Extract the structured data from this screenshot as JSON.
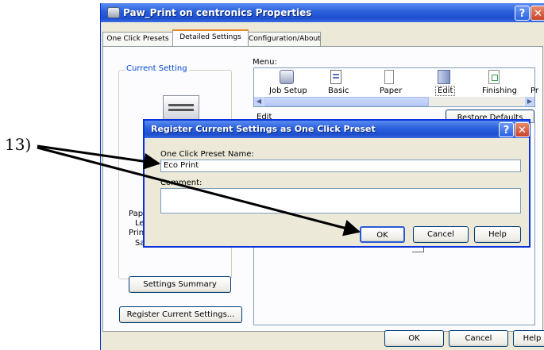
{
  "window": {
    "title": "Paw_Print on centronics Properties"
  },
  "tabs": [
    {
      "label": "One Click Presets"
    },
    {
      "label": "Detailed Settings"
    },
    {
      "label": "Configuration/About"
    }
  ],
  "left_panel": {
    "current_setting_label": "Current Setting",
    "info_lines": [
      "Pape",
      "Lett",
      "Print",
      "San"
    ],
    "settings_summary_button": "Settings Summary",
    "register_button": "Register Current Settings..."
  },
  "menu": {
    "label": "Menu:",
    "items": [
      {
        "label": "Job Setup",
        "icon": "job-setup-icon"
      },
      {
        "label": "Basic",
        "icon": "basic-icon"
      },
      {
        "label": "Paper",
        "icon": "paper-icon"
      },
      {
        "label": "Edit",
        "icon": "edit-icon"
      },
      {
        "label": "Finishing",
        "icon": "finishing-icon"
      },
      {
        "label": "Pr",
        "icon": ""
      }
    ],
    "selected": "Edit"
  },
  "edit_section": {
    "label": "Edit",
    "restore_defaults": "Restore Defaults"
  },
  "dialog": {
    "title": "Register Current Settings as One Click Preset",
    "name_label": "One Click Preset Name:",
    "name_value": "Eco Print",
    "comment_label": "Comment:",
    "comment_value": "",
    "ok": "OK",
    "cancel": "Cancel",
    "help": "Help"
  },
  "bottom_buttons": {
    "ok": "OK",
    "cancel": "Cancel",
    "help": "Help"
  },
  "annotation": {
    "label": "13)"
  },
  "colors": {
    "titlebar": "#2a5fdc",
    "selected_tab_accent": "#e68b2c",
    "window_bg": "#ece9d8",
    "close_button": "#c8452a"
  }
}
